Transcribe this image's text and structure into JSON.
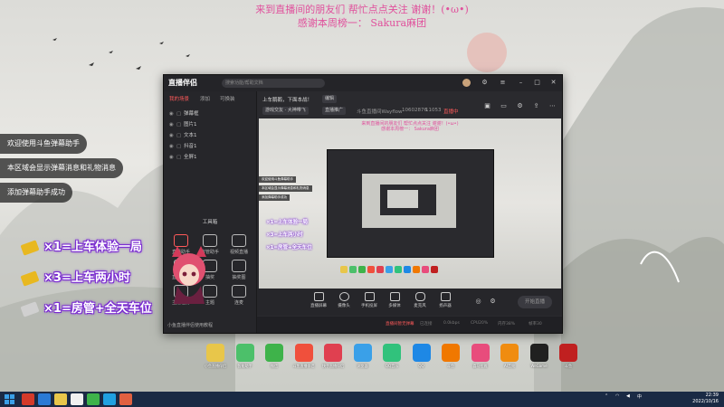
{
  "banner": {
    "line1": "来到直播间的朋友们 帮忙点点关注 谢谢！(•ω•)",
    "line2": "感谢本周榜一： Sakura麻团"
  },
  "chat": [
    "欢迎使用斗鱼弹幕助手",
    "本区域会显示弹幕消息和礼物消息",
    "添加弹幕助手成功"
  ],
  "gifts": [
    {
      "text": "×1=上车体验一局",
      "color": "#e8b820"
    },
    {
      "text": "×3=上车两小时",
      "color": "#e8b820"
    },
    {
      "text": "×1=房管+全天车位",
      "color": "#c8c8c8"
    }
  ],
  "app": {
    "logo": "直播伴侣",
    "search_placeholder": "搜索功能/帮助文档",
    "left_tabs": [
      "我的场景",
      "添加",
      "可换装"
    ],
    "scenes": [
      "弹幕框",
      "图片1",
      "文本1",
      "抖音1",
      "全屏1"
    ],
    "tools_title": "工具箱",
    "tools": [
      "直播助手",
      "房管助手",
      "视频直播",
      "直播下载",
      "抽奖",
      "抽奖图",
      "主播任务",
      "主题",
      "连麦"
    ],
    "footer": "小鱼直播伴侣使用教程",
    "head": {
      "title": "上车鹅鹅，下面本战！",
      "edit": "编辑",
      "category": "游戏交友 · 大神带飞",
      "share": "直播推广",
      "room": "斗鱼直播间Wayflow",
      "room_id": "10602876",
      "fans": "11053",
      "status": "直播中"
    },
    "controls": [
      "直播屏幕",
      "摄像头",
      "手机投屏",
      "多媒体",
      "麦克风",
      "扬声器"
    ],
    "start_btn": "开始直播",
    "status_items": [
      "直播间暂无弹幕",
      "已连接",
      "0.0kbps",
      "CPU20%",
      "内存38%",
      "帧率30"
    ]
  },
  "desktop_icons": [
    {
      "label": "小鱼直播伴侣",
      "color": "#e8c64a"
    },
    {
      "label": "智能助手",
      "color": "#4cc06a"
    },
    {
      "label": "微信",
      "color": "#3eb34a"
    },
    {
      "label": "斗鱼直播伴侣",
      "color": "#f0503c"
    },
    {
      "label": "快手直播伴侣",
      "color": "#e04050"
    },
    {
      "label": "浏览器",
      "color": "#3aa0e8"
    },
    {
      "label": "QQ音乐",
      "color": "#31c27c"
    },
    {
      "label": "QQ",
      "color": "#1e88e5"
    },
    {
      "label": "斗鱼",
      "color": "#f07800"
    },
    {
      "label": "喜马拉雅",
      "color": "#e84c7c"
    },
    {
      "label": "AI音效",
      "color": "#f08c10"
    },
    {
      "label": "WeGame",
      "color": "#202020"
    },
    {
      "label": "斗鱼",
      "color": "#c02020"
    }
  ],
  "taskbar": {
    "time": "22:39",
    "date": "2022/10/16",
    "apps": [
      "#d43a2a",
      "#2a7ad4",
      "#e8c64a",
      "#f0f0f0",
      "#3eb34a",
      "#20a0e0",
      "#e06040"
    ]
  }
}
